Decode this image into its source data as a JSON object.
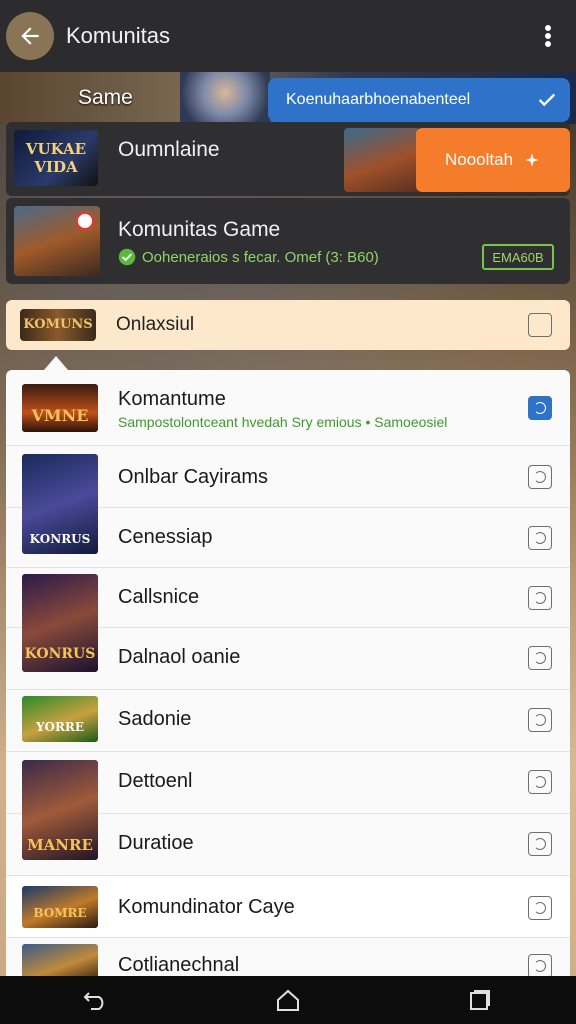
{
  "topbar": {
    "title": "Komunitas",
    "back_icon": "arrow-left-icon",
    "menu_icon": "more-vert-icon"
  },
  "banner": {
    "label": "Same",
    "pill_text": "Koenuhaarbhoenabenteel",
    "pill_icon": "check-icon",
    "pill_color": "#2f72c9"
  },
  "card1": {
    "thumb_text": "VUKAE VIDA",
    "title": "Oumnlaine",
    "button_label": "Noooltah",
    "button_icon": "sparkle-icon",
    "button_color": "#f47c2a"
  },
  "card2": {
    "title": "Komunitas Game",
    "subtitle": "Ooheneraios s fecar. Omef (3: B60)",
    "badge": "EMA60B",
    "accent": "#8fd46a"
  },
  "highlight_row": {
    "thumb_text": "KOMUNS",
    "label": "Onlaxsiul",
    "bg": "#fde8cc"
  },
  "list": [
    {
      "thumb_text": "VMNE",
      "title": "Komantume",
      "subtitle": "Sampostolontceant hvedah Sry emious • Samoeosiel",
      "icon": "sync-icon",
      "active": true
    },
    {
      "thumb_text": "KONRUS",
      "title": "Onlbar Cayirams",
      "icon": "sync-icon"
    },
    {
      "thumb_text": "",
      "title": "Cenessiap",
      "icon": "sync-icon"
    },
    {
      "thumb_text": "KONRUS",
      "title": "Callsnice",
      "icon": "sync-icon"
    },
    {
      "thumb_text": "",
      "title": "Dalnaol oanie",
      "icon": "sync-icon"
    },
    {
      "thumb_text": "YORRE",
      "title": "Sadonie",
      "icon": "sync-icon"
    },
    {
      "thumb_text": "",
      "title": "Dettoenl",
      "icon": "sync-icon"
    },
    {
      "thumb_text": "MANRE",
      "title": "Duratioe",
      "icon": "sync-icon"
    },
    {
      "thumb_text": "BOMRE",
      "title": "Komundinator Caye",
      "icon": "sync-icon"
    },
    {
      "thumb_text": "",
      "title": "Cotlianechnal",
      "icon": "sync-icon"
    }
  ],
  "navbar": {
    "back_icon": "back-nav-icon",
    "home_icon": "home-icon",
    "recents_icon": "recents-icon"
  }
}
